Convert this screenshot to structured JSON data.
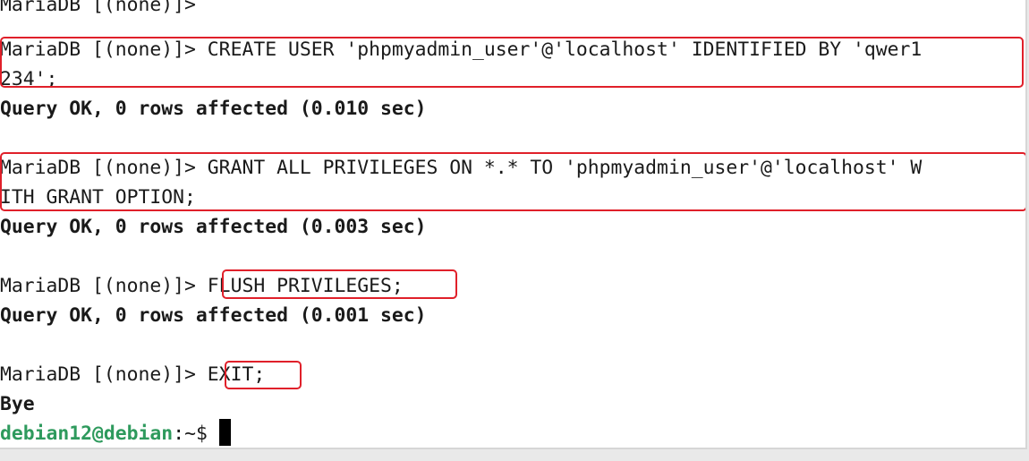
{
  "terminal": {
    "lines": [
      "MariaDB [(none)]>",
      "MariaDB [(none)]> CREATE USER 'phpmyadmin_user'@'localhost' IDENTIFIED BY 'qwer1",
      "234';",
      "Query OK, 0 rows affected (0.010 sec)",
      "",
      "MariaDB [(none)]> GRANT ALL PRIVILEGES ON *.* TO 'phpmyadmin_user'@'localhost' W",
      "ITH GRANT OPTION;",
      "Query OK, 0 rows affected (0.003 sec)",
      "",
      "MariaDB [(none)]> FLUSH PRIVILEGES;",
      "Query OK, 0 rows affected (0.001 sec)",
      "",
      "MariaDB [(none)]> EXIT;",
      "Bye"
    ],
    "prompt_user": "debian12@debian",
    "prompt_path": ":~$ "
  },
  "colors": {
    "highlight": "#e0202a",
    "prompt_user": "#2e9a5d"
  }
}
